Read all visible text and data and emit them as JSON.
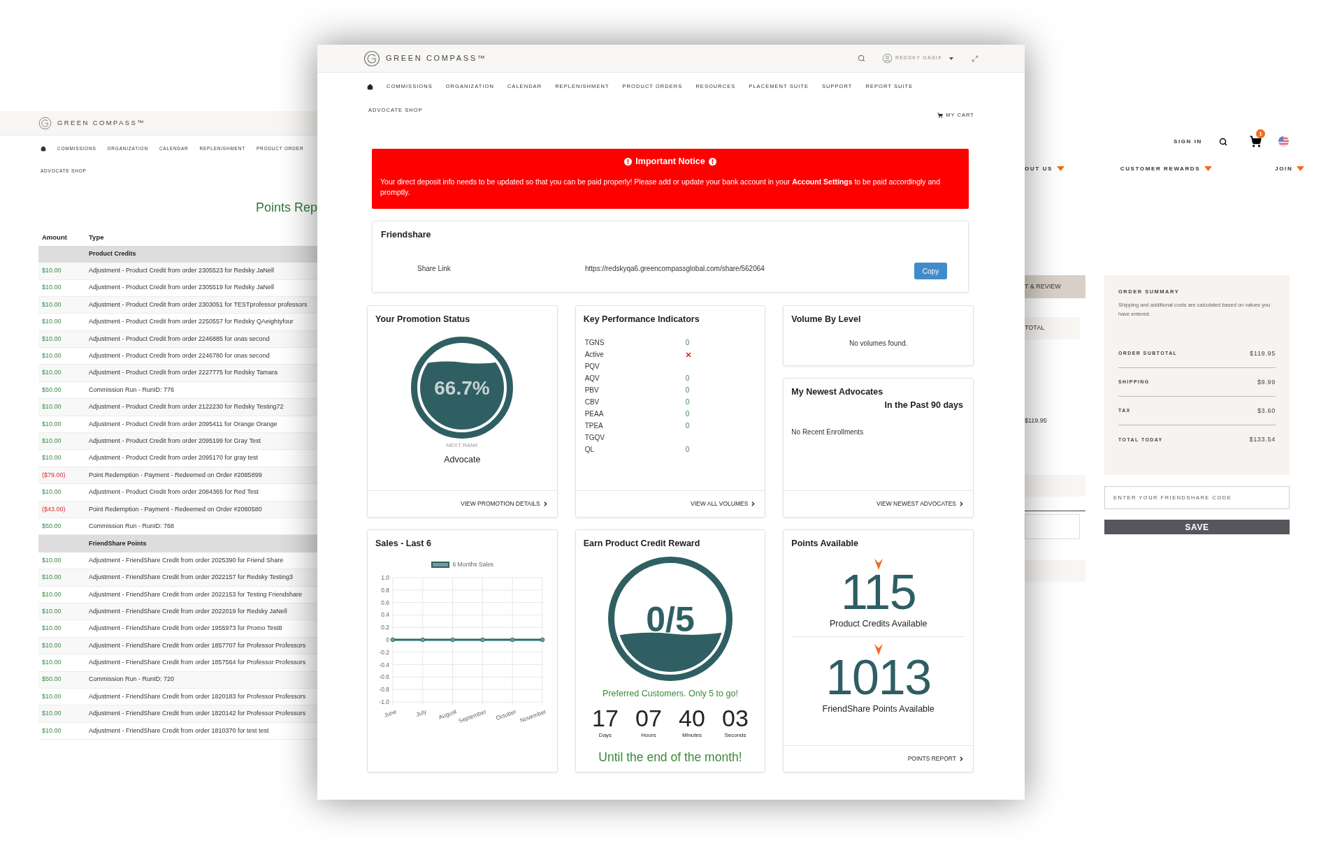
{
  "left_screen": {
    "brand": "GREEN COMPASS™",
    "nav": [
      "COMMISSIONS",
      "ORGANIZATION",
      "CALENDAR",
      "REPLENISHMENT",
      "PRODUCT ORDER"
    ],
    "shop_link": "ADVOCATE SHOP",
    "title": "Points Rep",
    "columns": [
      "Amount",
      "Type"
    ],
    "rows": [
      {
        "kind": "section",
        "type": "Product Credits"
      },
      {
        "kind": "entry",
        "amount": "$10.00",
        "negative": false,
        "type": "Adjustment - Product Credit from order 2305523 for Redsky JaNell"
      },
      {
        "kind": "entry",
        "amount": "$10.00",
        "negative": false,
        "type": "Adjustment - Product Credit from order 2305519 for Redsky JaNell"
      },
      {
        "kind": "entry",
        "amount": "$10.00",
        "negative": false,
        "type": "Adjustment - Product Credit from order 2303051 for TESTprofessor professors"
      },
      {
        "kind": "entry",
        "amount": "$10.00",
        "negative": false,
        "type": "Adjustment - Product Credit from order 2250557 for Redsky QAeightyfour"
      },
      {
        "kind": "entry",
        "amount": "$10.00",
        "negative": false,
        "type": "Adjustment - Product Credit from order 2246885 for onas second"
      },
      {
        "kind": "entry",
        "amount": "$10.00",
        "negative": false,
        "type": "Adjustment - Product Credit from order 2246780 for onas second"
      },
      {
        "kind": "entry",
        "amount": "$10.00",
        "negative": false,
        "type": "Adjustment - Product Credit from order 2227775 for Redsky Tamara"
      },
      {
        "kind": "entry",
        "amount": "$50.00",
        "negative": false,
        "type": "Commission Run - RunID: 776"
      },
      {
        "kind": "entry",
        "amount": "$10.00",
        "negative": false,
        "type": "Adjustment - Product Credit from order 2122230 for Redsky Testing72"
      },
      {
        "kind": "entry",
        "amount": "$10.00",
        "negative": false,
        "type": "Adjustment - Product Credit from order 2095411 for Orange Orange"
      },
      {
        "kind": "entry",
        "amount": "$10.00",
        "negative": false,
        "type": "Adjustment - Product Credit from order 2095199 for Gray Test"
      },
      {
        "kind": "entry",
        "amount": "$10.00",
        "negative": false,
        "type": "Adjustment - Product Credit from order 2095170 for gray test"
      },
      {
        "kind": "entry",
        "amount": "($79.00)",
        "negative": true,
        "type": "Point Redemption - Payment - Redeemed on Order #2085899"
      },
      {
        "kind": "entry",
        "amount": "$10.00",
        "negative": false,
        "type": "Adjustment - Product Credit from order 2084365 for Red Test"
      },
      {
        "kind": "entry",
        "amount": "($43.00)",
        "negative": true,
        "type": "Point Redemption - Payment - Redeemed on Order #2080580"
      },
      {
        "kind": "entry",
        "amount": "$50.00",
        "negative": false,
        "type": "Commission Run - RunID: 768"
      },
      {
        "kind": "section",
        "type": "FriendShare Points"
      },
      {
        "kind": "entry",
        "amount": "$10.00",
        "negative": false,
        "type": "Adjustment - FriendShare Credit from order 2025390 for Friend Share"
      },
      {
        "kind": "entry",
        "amount": "$10.00",
        "negative": false,
        "type": "Adjustment - FriendShare Credit from order 2022157 for Redsky Testing3"
      },
      {
        "kind": "entry",
        "amount": "$10.00",
        "negative": false,
        "type": "Adjustment - FriendShare Credit from order 2022153 for Testing Friendshare"
      },
      {
        "kind": "entry",
        "amount": "$10.00",
        "negative": false,
        "type": "Adjustment - FriendShare Credit from order 2022019 for Redsky JaNell"
      },
      {
        "kind": "entry",
        "amount": "$10.00",
        "negative": false,
        "type": "Adjustment - FriendShare Credit from order 1955973 for Promo Test8"
      },
      {
        "kind": "entry",
        "amount": "$10.00",
        "negative": false,
        "type": "Adjustment - FriendShare Credit from order 1857707 for Professor Professors"
      },
      {
        "kind": "entry",
        "amount": "$10.00",
        "negative": false,
        "type": "Adjustment - FriendShare Credit from order 1857564 for Professor Professors"
      },
      {
        "kind": "entry",
        "amount": "$50.00",
        "negative": false,
        "type": "Commission Run - RunID: 720"
      },
      {
        "kind": "entry",
        "amount": "$10.00",
        "negative": false,
        "type": "Adjustment - FriendShare Credit from order 1820183 for Professor Professors"
      },
      {
        "kind": "entry",
        "amount": "$10.00",
        "negative": false,
        "type": "Adjustment - FriendShare Credit from order 1820142 for Professor Professors"
      },
      {
        "kind": "entry",
        "amount": "$10.00",
        "negative": false,
        "type": "Adjustment - FriendShare Credit from order 1810370 for test test"
      }
    ]
  },
  "main_screen": {
    "brand": "GREEN COMPASS™",
    "user": "REDSKY OASIX",
    "nav": [
      "COMMISSIONS",
      "ORGANIZATION",
      "CALENDAR",
      "REPLENISHMENT",
      "PRODUCT ORDERS",
      "RESOURCES",
      "PLACEMENT SUITE",
      "SUPPORT",
      "REPORT SUITE"
    ],
    "shop_link": "ADVOCATE SHOP",
    "cart": "MY CART",
    "notice": {
      "title": "Important Notice",
      "text": "Your direct deposit info needs to be updated so that you can be paid properly! Please add or update your bank account in your **Account Settings** to be paid accordingly and promptly."
    },
    "friendshare": {
      "title": "Friendshare",
      "label": "Share Link",
      "url": "https://redskyqa6.greencompassglobal.com/share/562064",
      "button": "Copy"
    },
    "promotion": {
      "title": "Your Promotion Status",
      "percent": "66.7%",
      "caption": "NEXT RANK",
      "rank": "Advocate",
      "link": "VIEW PROMOTION DETAILS"
    },
    "kpi": {
      "title": "Key Performance Indicators",
      "rows": [
        {
          "label": "TGNS",
          "kind": "value",
          "value": "0"
        },
        {
          "label": "Active",
          "kind": "cross"
        },
        {
          "label": "PQV",
          "kind": "empty"
        },
        {
          "label": "AQV",
          "kind": "value",
          "value": "0"
        },
        {
          "label": "PBV",
          "kind": "value",
          "value": "0"
        },
        {
          "label": "CBV",
          "kind": "value",
          "value": "0"
        },
        {
          "label": "PEAA",
          "kind": "value",
          "value": "0"
        },
        {
          "label": "TPEA",
          "kind": "value",
          "value": "0"
        },
        {
          "label": "TGQV",
          "kind": "empty"
        },
        {
          "label": "QL",
          "kind": "value",
          "value": "0"
        }
      ],
      "link": "VIEW ALL VOLUMES"
    },
    "volume": {
      "title": "Volume By Level",
      "empty": "No volumes found."
    },
    "newest": {
      "title": "My Newest Advocates",
      "subtitle": "In the Past 90 days",
      "empty": "No Recent Enrollments",
      "link": "VIEW NEWEST ADVOCATES"
    },
    "sales": {
      "title": "Sales - Last 6",
      "chart_data": {
        "type": "line",
        "categories": [
          "June",
          "July",
          "August",
          "September",
          "October",
          "November"
        ],
        "series": [
          {
            "name": "6 Months Sales",
            "color": "#2f6b6b",
            "marker": true,
            "values": [
              0,
              0,
              0,
              0,
              0,
              0
            ]
          }
        ],
        "grid": true,
        "ylim": [
          -1,
          1
        ],
        "yticks": [
          {
            "value": 1,
            "label": "1.0"
          },
          {
            "value": 0.8,
            "label": "0.8"
          },
          {
            "value": 0.6,
            "label": "0.6"
          },
          {
            "value": 0.4,
            "label": "0.4"
          },
          {
            "value": 0.2,
            "label": "0.2"
          },
          {
            "value": 0,
            "label": "0"
          },
          {
            "value": -0.2,
            "label": "-0.2"
          },
          {
            "value": -0.4,
            "label": "-0.4"
          },
          {
            "value": -0.6,
            "label": "-0.6"
          },
          {
            "value": -0.8,
            "label": "-0.8"
          },
          {
            "value": -1,
            "label": "-1.0"
          }
        ]
      }
    },
    "reward": {
      "title": "Earn Product Credit Reward",
      "count": "0/5",
      "message": "Preferred Customers. Only 5 to go!",
      "countdown": [
        {
          "value": "17",
          "unit": "Days"
        },
        {
          "value": "07",
          "unit": "Hours"
        },
        {
          "value": "40",
          "unit": "Minutes"
        },
        {
          "value": "03",
          "unit": "Seconds"
        }
      ],
      "footer": "Until the end of the month!"
    },
    "points": {
      "title": "Points Available",
      "items": [
        {
          "value": "115",
          "label": "Product Credits Available"
        },
        {
          "value": "1013",
          "label": "FriendShare Points Available"
        }
      ],
      "link": "POINTS REPORT"
    }
  },
  "right_screen": {
    "sign_in": "SIGN IN",
    "cart_count": "1",
    "nav": [
      "OUT US",
      "CUSTOMER REWARDS",
      "JOIN"
    ],
    "step_tab": "T & REVIEW",
    "total_label": "TOTAL",
    "total_value": "$119.95",
    "summary": {
      "title": "ORDER SUMMARY",
      "note": "Shipping and additional costs are calculated based on values you have entered.",
      "rows": [
        {
          "label": "ORDER SUBTOTAL",
          "value": "$119.95"
        },
        {
          "label": "SHIPPING",
          "value": "$9.99"
        },
        {
          "label": "TAX",
          "value": "$3.60"
        },
        {
          "label": "TOTAL TODAY",
          "value": "$133.54"
        }
      ]
    },
    "code_field": {
      "placeholder": "ENTER YOUR FRIENDSHARE CODE"
    },
    "save": "SAVE"
  }
}
